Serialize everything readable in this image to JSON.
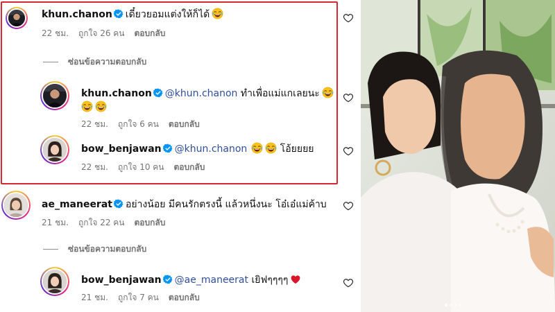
{
  "comments": [
    {
      "username": "khun.chanon",
      "text": "เดี๋ยวยอมแต่งให้ก็ได้",
      "time": "22 ชม.",
      "likes": "ถูกใจ 26 คน",
      "reply": "ตอบกลับ"
    },
    {
      "hide_replies": "ซ่อนข้อความตอบกลับ",
      "replies": [
        {
          "username": "khun.chanon",
          "mention": "@khun.chanon",
          "text": "ทำเพื่อแม่แกเลยนะ",
          "time": "22 ชม.",
          "likes": "ถูกใจ 6 คน",
          "reply": "ตอบกลับ"
        },
        {
          "username": "bow_benjawan",
          "mention": "@khun.chanon",
          "text": "โอ้ยยยย",
          "time": "22 ชม.",
          "likes": "ถูกใจ 10 คน",
          "reply": "ตอบกลับ"
        }
      ]
    },
    {
      "username": "ae_maneerat",
      "text": "อย่างน้อย มีคนรักตรงนี้ แล้วหนึ่งนะ โอ๋เอ๋แม่ค้าบ",
      "time": "21 ชม.",
      "likes": "ถูกใจ 22 คน",
      "reply": "ตอบกลับ"
    },
    {
      "hide_replies": "ซ่อนข้อความตอบกลับ",
      "replies": [
        {
          "username": "bow_benjawan",
          "mention": "@ae_maneerat",
          "text": "เยิฟๆๆๆๆ",
          "time": "21 ชม.",
          "likes": "ถูกใจ 7 คน",
          "reply": "ตอบกลับ"
        }
      ]
    }
  ],
  "icons": {
    "verified": "verified-badge-icon",
    "like": "heart-outline-icon",
    "laugh_emoji": "tears-of-joy-emoji",
    "red_heart_emoji": "red-heart-emoji"
  },
  "colors": {
    "highlight_border": "#d8282f",
    "verified_blue": "#0095f6",
    "mention": "#2f4e9c",
    "meta_gray": "#737373"
  },
  "carousel": {
    "total": 4,
    "active": 1
  }
}
